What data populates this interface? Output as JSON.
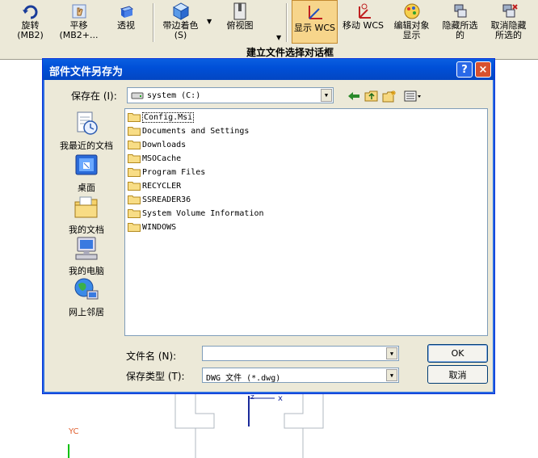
{
  "toolbar": {
    "buttons": [
      {
        "label": "旋转",
        "sub": "(MB2)"
      },
      {
        "label": "平移",
        "sub": "(MB2+..."
      },
      {
        "label": "透视",
        "sub": ""
      },
      {
        "label": "带边着色",
        "sub": "(S)"
      },
      {
        "label": "俯视图",
        "sub": ""
      },
      {
        "label": "显示 WCS",
        "sub": ""
      },
      {
        "label": "移动 WCS",
        "sub": ""
      },
      {
        "label": "编辑对象",
        "sub": "显示"
      },
      {
        "label": "隐藏所选",
        "sub": "的"
      },
      {
        "label": "取消隐藏",
        "sub": "所选的"
      }
    ],
    "strip_title": "建立文件选择对话框"
  },
  "graphics": {
    "axis_x": "x",
    "axis_z": "z",
    "yc_label": "YC"
  },
  "dialog": {
    "title": "部件文件另存为",
    "help": "?",
    "close": "×",
    "save_in_label": "保存在 (I):",
    "save_in_value": "system (C:)",
    "places": [
      {
        "label": "我最近的文档",
        "icon": "recent-documents-icon"
      },
      {
        "label": "桌面",
        "icon": "desktop-icon"
      },
      {
        "label": "我的文档",
        "icon": "my-documents-icon"
      },
      {
        "label": "我的电脑",
        "icon": "my-computer-icon"
      },
      {
        "label": "网上邻居",
        "icon": "network-places-icon"
      }
    ],
    "files": [
      "Config.Msi",
      "Documents and Settings",
      "Downloads",
      "MSOCache",
      "Program Files",
      "RECYCLER",
      "SSREADER36",
      "System Volume Information",
      "WINDOWS"
    ],
    "filename_label": "文件名 (N):",
    "filename_value": "",
    "filetype_label": "保存类型 (T):",
    "filetype_value": "DWG 文件 (*.dwg)",
    "ok_label": "OK",
    "cancel_label": "取消"
  }
}
